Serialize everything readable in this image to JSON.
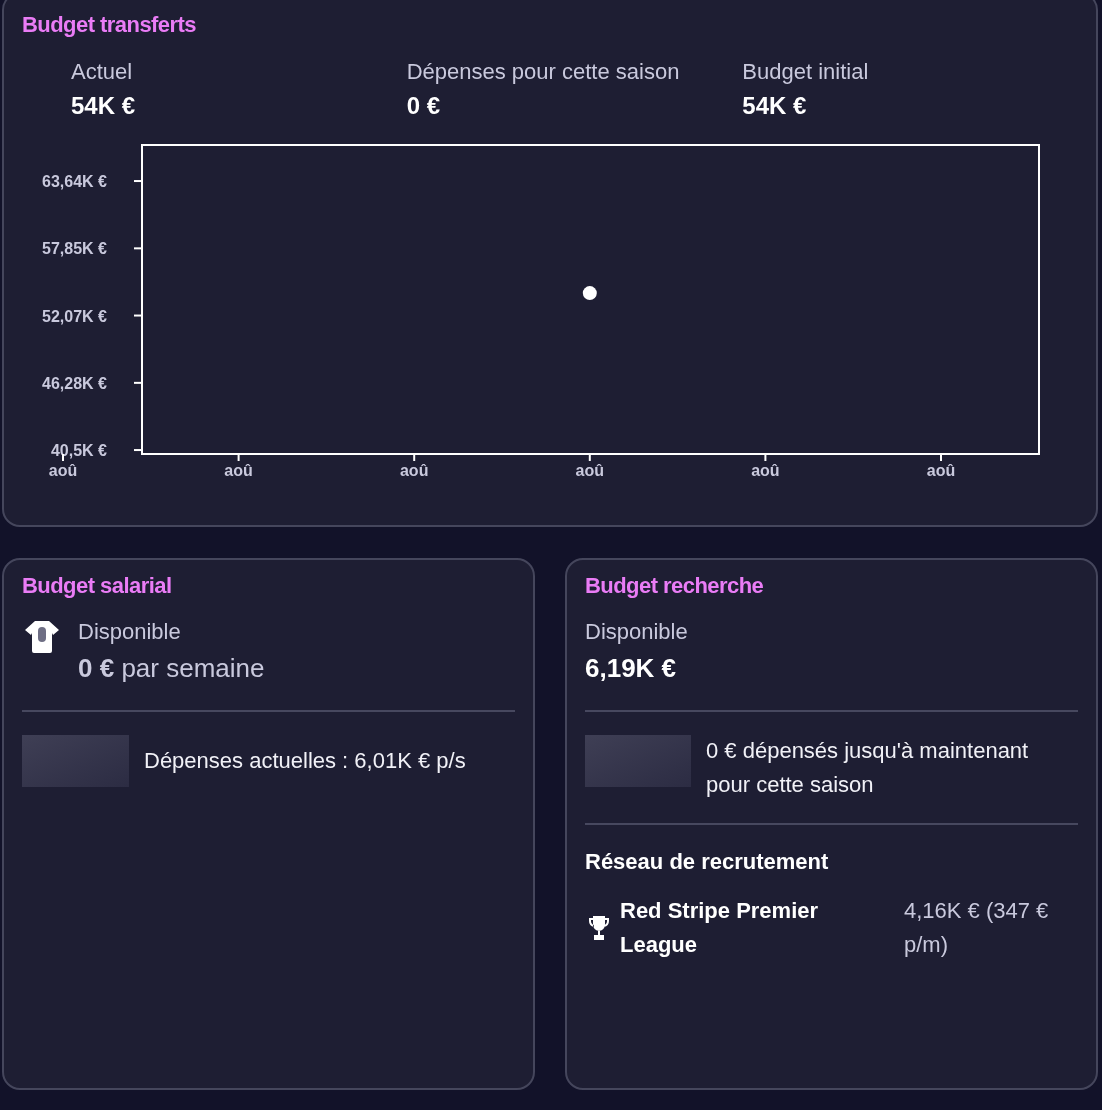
{
  "transfer_budget": {
    "title": "Budget transferts",
    "stats": [
      {
        "label": "Actuel",
        "value": "54K €"
      },
      {
        "label": "Dépenses pour cette saison",
        "value": "0 €"
      },
      {
        "label": "Budget initial",
        "value": "54K €"
      }
    ],
    "chart_data": {
      "type": "scatter",
      "categories": [
        "aoû",
        "aoû",
        "aoû",
        "aoû",
        "aoû",
        "aoû"
      ],
      "values": [
        null,
        null,
        null,
        54,
        null,
        null
      ],
      "yticks": [
        {
          "value": 63.64,
          "label": "63,64K €"
        },
        {
          "value": 57.85,
          "label": "57,85K €"
        },
        {
          "value": 52.07,
          "label": "52,07K €"
        },
        {
          "value": 46.28,
          "label": "46,28K €"
        },
        {
          "value": 40.5,
          "label": "40,5K €"
        }
      ],
      "ylim": [
        40.16,
        66.74
      ]
    }
  },
  "wage_budget": {
    "title": "Budget salarial",
    "available_label": "Disponible",
    "available_value": "**0 €** par semaine",
    "current_spend": "Dépenses actuelles : 6,01K € p/s"
  },
  "scouting_budget": {
    "title": "Budget recherche",
    "available_label": "Disponible",
    "available_value": "6,19K €",
    "spent_text": "0 € dépensés jusqu'à maintenant pour cette saison",
    "network_heading": "Réseau de recrutement",
    "networks": [
      {
        "name": "Red Stripe Premier League",
        "cost": "4,16K € (347 € p/m)"
      }
    ]
  }
}
